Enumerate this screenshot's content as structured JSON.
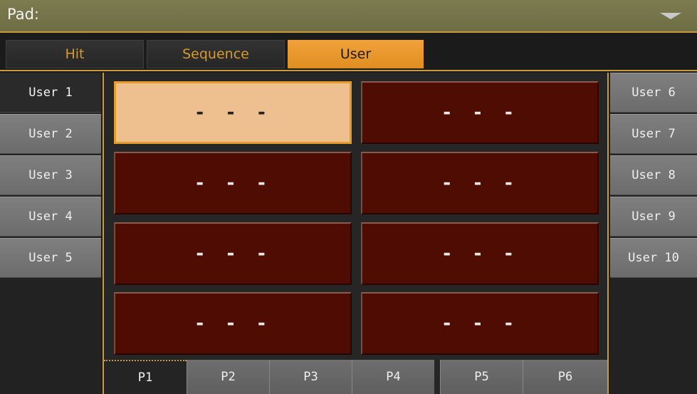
{
  "header": {
    "title": "Pad:"
  },
  "tabs": [
    {
      "label": "Hit",
      "active": false
    },
    {
      "label": "Sequence",
      "active": false
    },
    {
      "label": "User",
      "active": true
    }
  ],
  "left_slots": [
    "User 1",
    "User 2",
    "User 3",
    "User 4",
    "User 5"
  ],
  "right_slots": [
    "User 6",
    "User 7",
    "User 8",
    "User 9",
    "User 10"
  ],
  "selected_slot": "User 1",
  "pads": [
    "- - -",
    "- - -",
    "- - -",
    "- - -",
    "- - -",
    "- - -",
    "- - -",
    "- - -"
  ],
  "selected_pad_index": 0,
  "pages": [
    "P1",
    "P2",
    "P3",
    "P4",
    "P5",
    "P6"
  ],
  "selected_page": "P1",
  "colors": {
    "accent": "#e59b2a",
    "pad": "#4e0c02",
    "pad_selected": "#efc08f"
  }
}
